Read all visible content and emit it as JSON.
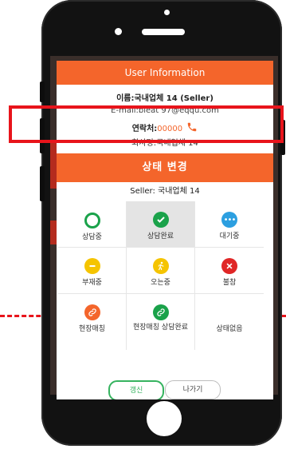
{
  "modal": {
    "title": "User Information",
    "info_name_label": "이름:",
    "info_name_value": "국내업체 14 (Seller)",
    "info_email": "E-mail:bleat 97@eqqu.com",
    "info_contact_label": "연락처:",
    "info_contact_value": "00000",
    "info_company": "회사명:국내업체 14",
    "status_title": "상태 변경",
    "seller_line": "Seller: 국내업체 14"
  },
  "status_options": [
    {
      "label": "상담중",
      "icon": "circle-outline-icon",
      "color": "#1aa24a"
    },
    {
      "label": "상담완료",
      "icon": "check-circle-icon",
      "color": "#1aa24a",
      "selected": true
    },
    {
      "label": "대기중",
      "icon": "more-dots-icon",
      "color": "#2c9fe0"
    },
    {
      "label": "부재중",
      "icon": "minus-circle-icon",
      "color": "#f5c400"
    },
    {
      "label": "오는중",
      "icon": "running-person-icon",
      "color": "#f5c400"
    },
    {
      "label": "불참",
      "icon": "x-circle-icon",
      "color": "#e02626"
    },
    {
      "label": "현장매칭",
      "icon": "link-icon",
      "color": "#f4652b"
    },
    {
      "label": "현장매칭 상담완료",
      "icon": "link-icon",
      "color": "#1aa24a"
    },
    {
      "label": "상태없음",
      "icon": "",
      "color": ""
    }
  ],
  "buttons": {
    "refresh_label": "갱신",
    "exit_label": "나가기"
  }
}
